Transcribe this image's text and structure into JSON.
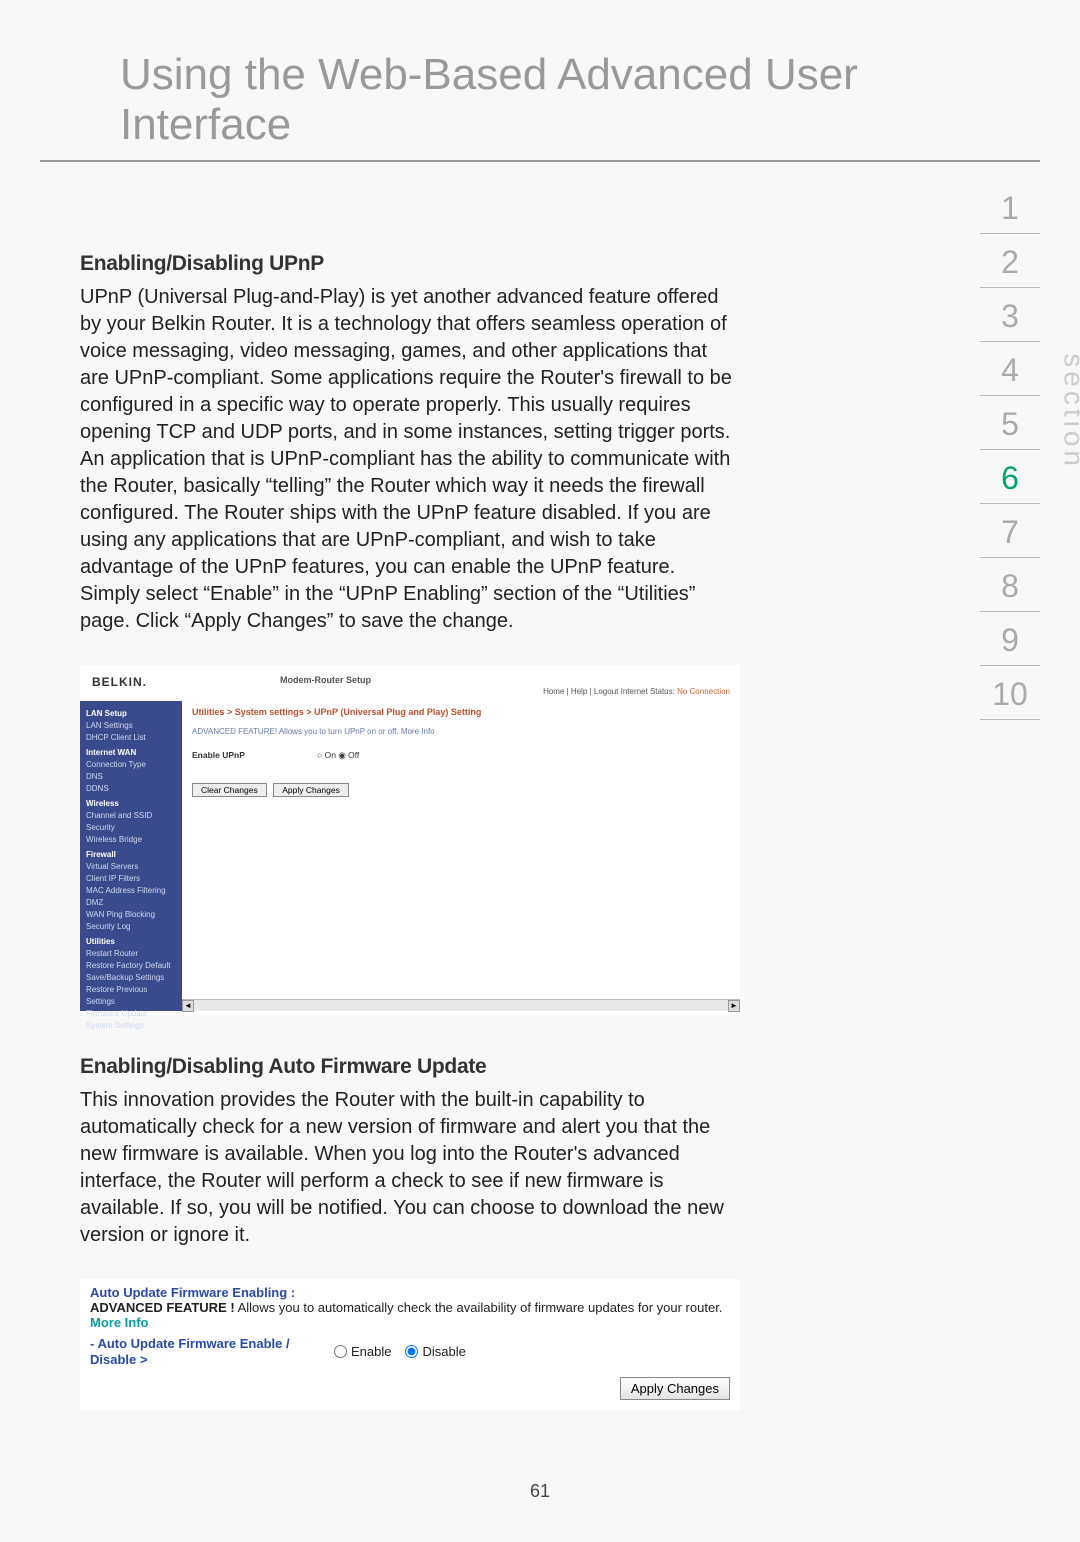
{
  "page": {
    "title": "Using the Web-Based Advanced User Interface",
    "number": "61",
    "section_label": "section"
  },
  "nav": {
    "items": [
      "1",
      "2",
      "3",
      "4",
      "5",
      "6",
      "7",
      "8",
      "9",
      "10"
    ],
    "active_index": 5
  },
  "upnp": {
    "heading": "Enabling/Disabling UPnP",
    "body": "UPnP (Universal Plug-and-Play) is yet another advanced feature offered by your Belkin Router. It is a technology that offers seamless operation of voice messaging, video messaging, games, and other applications that are UPnP-compliant. Some applications require the Router's firewall to be configured in a specific way to operate properly. This usually requires opening TCP and UDP ports, and in some instances, setting trigger ports. An application that is UPnP-compliant has the ability to communicate with the Router, basically “telling” the Router which way it needs the firewall configured. The Router ships with the UPnP feature disabled. If you are using any applications that are UPnP-compliant, and wish to take advantage of the UPnP features, you can enable the UPnP feature. Simply select “Enable” in the “UPnP Enabling” section of the “Utilities” page. Click “Apply Changes” to save the change."
  },
  "router_ui": {
    "brand": "BELKIN.",
    "setup_title": "Modem-Router Setup",
    "toplinks_left": "Home | Help | Logout   Internet Status: ",
    "toplinks_status": "No Connection",
    "breadcrumb": "Utilities > System settings > UPnP (Universal Plug and Play) Setting",
    "feature_note": "ADVANCED FEATURE! Allows you to turn UPnP on or off. More Info",
    "enable_label": "Enable UPnP",
    "enable_opts": "○ On  ◉ Off",
    "btn_clear": "Clear Changes",
    "btn_apply": "Apply Changes",
    "sidebar": {
      "groups": [
        {
          "title": "LAN Setup",
          "items": [
            "LAN Settings",
            "DHCP Client List"
          ]
        },
        {
          "title": "Internet WAN",
          "items": [
            "Connection Type",
            "DNS",
            "DDNS"
          ]
        },
        {
          "title": "Wireless",
          "items": [
            "Channel and SSID",
            "Security",
            "Wireless Bridge"
          ]
        },
        {
          "title": "Firewall",
          "items": [
            "Virtual Servers",
            "Client IP Filters",
            "MAC Address Filtering",
            "DMZ",
            "WAN Ping Blocking",
            "Security Log"
          ]
        },
        {
          "title": "Utilities",
          "items": [
            "Restart Router",
            "Restore Factory Default",
            "Save/Backup Settings",
            "Restore Previous Settings",
            "Firmware Update",
            "System Settings"
          ]
        }
      ]
    }
  },
  "auto_fw": {
    "heading": "Enabling/Disabling Auto Firmware Update",
    "body": "This innovation provides the Router with the built-in capability to automatically check for a new version of firmware and alert you that the new firmware is available. When you log into the Router's advanced interface, the Router will perform a check to see if new firmware is available. If so, you will be notified. You can choose to download the new version or ignore it."
  },
  "auto_fw_ui": {
    "title": "Auto Update Firmware Enabling :",
    "feature_prefix": "ADVANCED FEATURE !",
    "feature_rest": " Allows you to automatically check the availability of firmware updates for your router. ",
    "more_info": "More Info",
    "option_label": "- Auto Update Firmware Enable / Disable >",
    "enable_label": "Enable",
    "disable_label": "Disable",
    "selected": "disable",
    "apply": "Apply Changes"
  }
}
